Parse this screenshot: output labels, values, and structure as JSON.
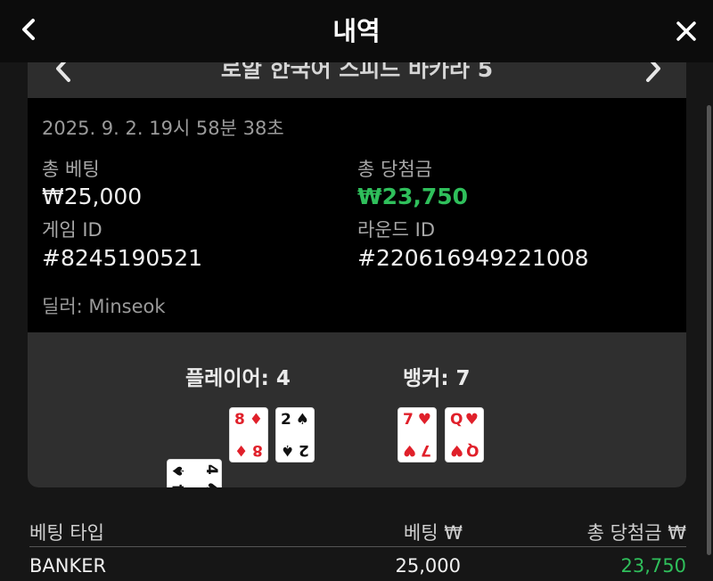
{
  "header": {
    "title": "내역"
  },
  "round": {
    "table_name": "로얄 한국어 스피드 바카라 5",
    "datetime": "2025. 9. 2. 19시 58분 38초",
    "total_bet_label": "총 베팅",
    "total_bet_value": "₩25,000",
    "total_win_label": "총 당첨금",
    "total_win_value": "₩23,750",
    "game_id_label": "게임 ID",
    "game_id_value": "#8245190521",
    "round_id_label": "라운드 ID",
    "round_id_value": "#220616949221008",
    "dealer": "딜러: Minseok"
  },
  "result": {
    "player_label": "플레이어: 4",
    "banker_label": "뱅커: 7",
    "player_cards": [
      {
        "rank": "4",
        "suit": "♠",
        "color": "black"
      },
      {
        "rank": "8",
        "suit": "♦",
        "color": "red"
      },
      {
        "rank": "2",
        "suit": "♠",
        "color": "black"
      }
    ],
    "banker_cards": [
      {
        "rank": "7",
        "suit": "♥",
        "color": "red"
      },
      {
        "rank": "Q",
        "suit": "♥",
        "color": "red"
      }
    ]
  },
  "bets": {
    "headers": {
      "type": "베팅 타입",
      "bet": "베팅 ₩",
      "win": "총 당첨금 ₩"
    },
    "rows": [
      {
        "type": "BANKER",
        "bet": "25,000",
        "win": "23,750"
      }
    ]
  },
  "colors": {
    "accent_blue": "#1e7fe6",
    "win_green": "#2fbf5b",
    "card_red": "#e0202a"
  },
  "icons": {
    "back": "chevron-left-icon",
    "expand": "expand-arrows-icon",
    "stop": "stop-square-icon",
    "close": "close-icon",
    "prev": "chevron-left-icon",
    "next": "chevron-right-icon"
  }
}
